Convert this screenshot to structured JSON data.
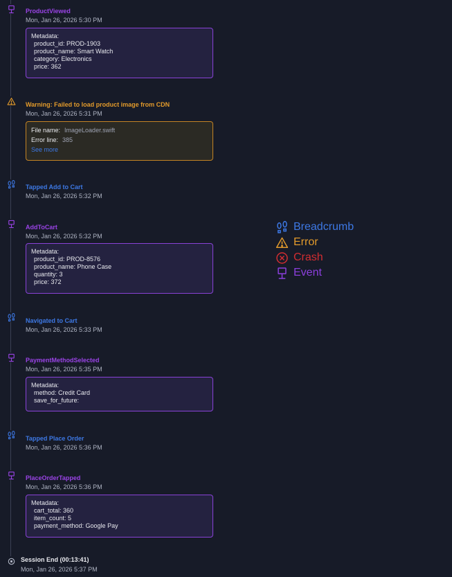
{
  "timeline": {
    "items": [
      {
        "kind": "event",
        "title": "ProductViewed",
        "timestamp": "Mon, Jan 26, 2026 5:30 PM",
        "metadata_label": "Metadata:",
        "metadata": [
          "product_id: PROD-1903",
          "product_name: Smart Watch",
          "category: Electronics",
          "price: 362"
        ]
      },
      {
        "kind": "warning",
        "title": "Warning: Failed to load product image from CDN",
        "timestamp": "Mon, Jan 26, 2026 5:31 PM",
        "file_name_label": "File name:",
        "file_name": "ImageLoader.swift",
        "error_line_label": "Error line:",
        "error_line": "385",
        "see_more": "See more"
      },
      {
        "kind": "breadcrumb",
        "title": "Tapped Add to Cart",
        "timestamp": "Mon, Jan 26, 2026 5:32 PM"
      },
      {
        "kind": "event",
        "title": "AddToCart",
        "timestamp": "Mon, Jan 26, 2026 5:32 PM",
        "metadata_label": "Metadata:",
        "metadata": [
          "product_id: PROD-8576",
          "product_name: Phone Case",
          "quantity: 3",
          "price: 372"
        ]
      },
      {
        "kind": "breadcrumb",
        "title": "Navigated to Cart",
        "timestamp": "Mon, Jan 26, 2026 5:33 PM"
      },
      {
        "kind": "event",
        "title": "PaymentMethodSelected",
        "timestamp": "Mon, Jan 26, 2026 5:35 PM",
        "metadata_label": "Metadata:",
        "metadata": [
          "method: Credit Card",
          "save_for_future:"
        ]
      },
      {
        "kind": "breadcrumb",
        "title": "Tapped Place Order",
        "timestamp": "Mon, Jan 26, 2026 5:36 PM"
      },
      {
        "kind": "event",
        "title": "PlaceOrderTapped",
        "timestamp": "Mon, Jan 26, 2026 5:36 PM",
        "metadata_label": "Metadata:",
        "metadata": [
          "cart_total: 360",
          "item_count: 5",
          "payment_method: Google Pay"
        ]
      },
      {
        "kind": "session-end",
        "title": "Session End (00:13:41)",
        "timestamp": "Mon, Jan 26, 2026 5:37 PM"
      }
    ]
  },
  "legend": {
    "breadcrumb": "Breadcrumb",
    "error": "Error",
    "crash": "Crash",
    "event": "Event"
  },
  "colors": {
    "background": "#171b28",
    "event": "#9a43e6",
    "breadcrumb": "#3d78e4",
    "warning": "#e29a2b",
    "crash": "#d32d31"
  },
  "icons": {
    "event": "monitor-icon",
    "warning": "warning-triangle-icon",
    "breadcrumb": "footprints-icon",
    "crash": "x-circle-icon",
    "session_end": "stop-circle-icon"
  }
}
